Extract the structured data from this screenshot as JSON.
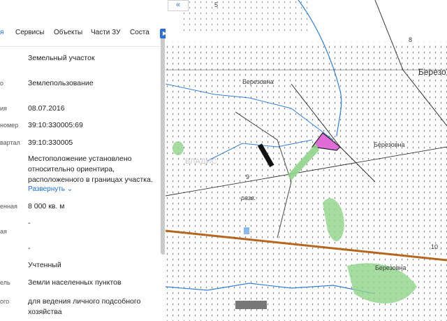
{
  "tabs": [
    {
      "label": "я"
    },
    {
      "label": "Сервисы"
    },
    {
      "label": "Объекты"
    },
    {
      "label": "Части ЗУ"
    },
    {
      "label": "Соста"
    }
  ],
  "rows": [
    {
      "label": "",
      "value": "Земельный участок"
    },
    {
      "label": "о",
      "value": "Землепользование"
    },
    {
      "label": "ия",
      "value": "08.07.2016"
    },
    {
      "label": "номер",
      "value": "39:10:330005:69"
    },
    {
      "label": "вартал",
      "value": "39:10:330005"
    },
    {
      "label": "",
      "value": "Местоположение установлено относительно ориентира, расположенного в границах участка."
    },
    {
      "label": "енная",
      "value": "8 000 кв. м"
    },
    {
      "label": "ая",
      "value": "-"
    },
    {
      "label": "",
      "value": "-"
    },
    {
      "label": "",
      "value": "Учтенный"
    },
    {
      "label": "ель",
      "value": "Земли населенных пунктов"
    },
    {
      "label": "ого",
      "value": "для ведения личного подсобного хозяйства"
    }
  ],
  "expand_link": "Развернуть",
  "map": {
    "labels": [
      "5",
      "8",
      "Березо",
      "Березовна",
      "Березовна",
      "9",
      "разв.",
      "10",
      "Березовна"
    ],
    "watermark": "ВЛАДИС",
    "parcel_color": "#e06cd8",
    "green_color": "#8fd48a",
    "road_color": "#b5651d"
  },
  "map_nav_icon": "double-chevron-left-icon"
}
